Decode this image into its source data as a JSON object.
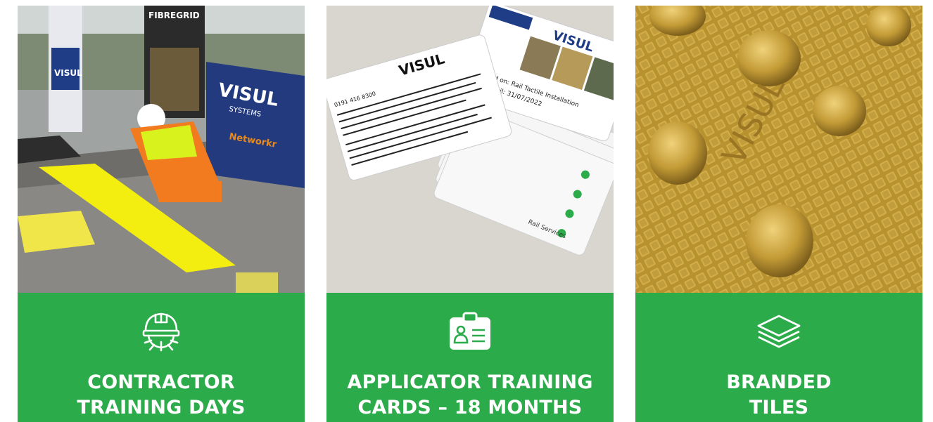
{
  "cards": [
    {
      "title_line1": "CONTRACTOR",
      "title_line2": "TRAINING DAYS",
      "icon": "hard-hat-gear-icon",
      "photo_text": {
        "banner_top": "FIBREGRID",
        "banner_brand": "VISUL",
        "banner_sub": "SYSTEMS",
        "banner_partner": "Networkr"
      }
    },
    {
      "title_line1": "APPLICATOR TRAINING",
      "title_line2": "CARDS – 18 MONTHS",
      "icon": "id-badge-icon",
      "photo_text": {
        "brand": "VISUL",
        "phone": "0191 416 8300",
        "trained_on": "Trained on: Rail Tactile Installation",
        "valid_until": "Valid Until: 31/07/2022",
        "rail_services": "Rail Services"
      }
    },
    {
      "title_line1": "BRANDED",
      "title_line2": "TILES",
      "icon": "stacked-layers-icon",
      "photo_text": {
        "tile_brand": "VISUL"
      }
    }
  ],
  "colors": {
    "panel_green": "#2bab49",
    "text_white": "#ffffff",
    "tile_gold": "#c9a43a"
  }
}
